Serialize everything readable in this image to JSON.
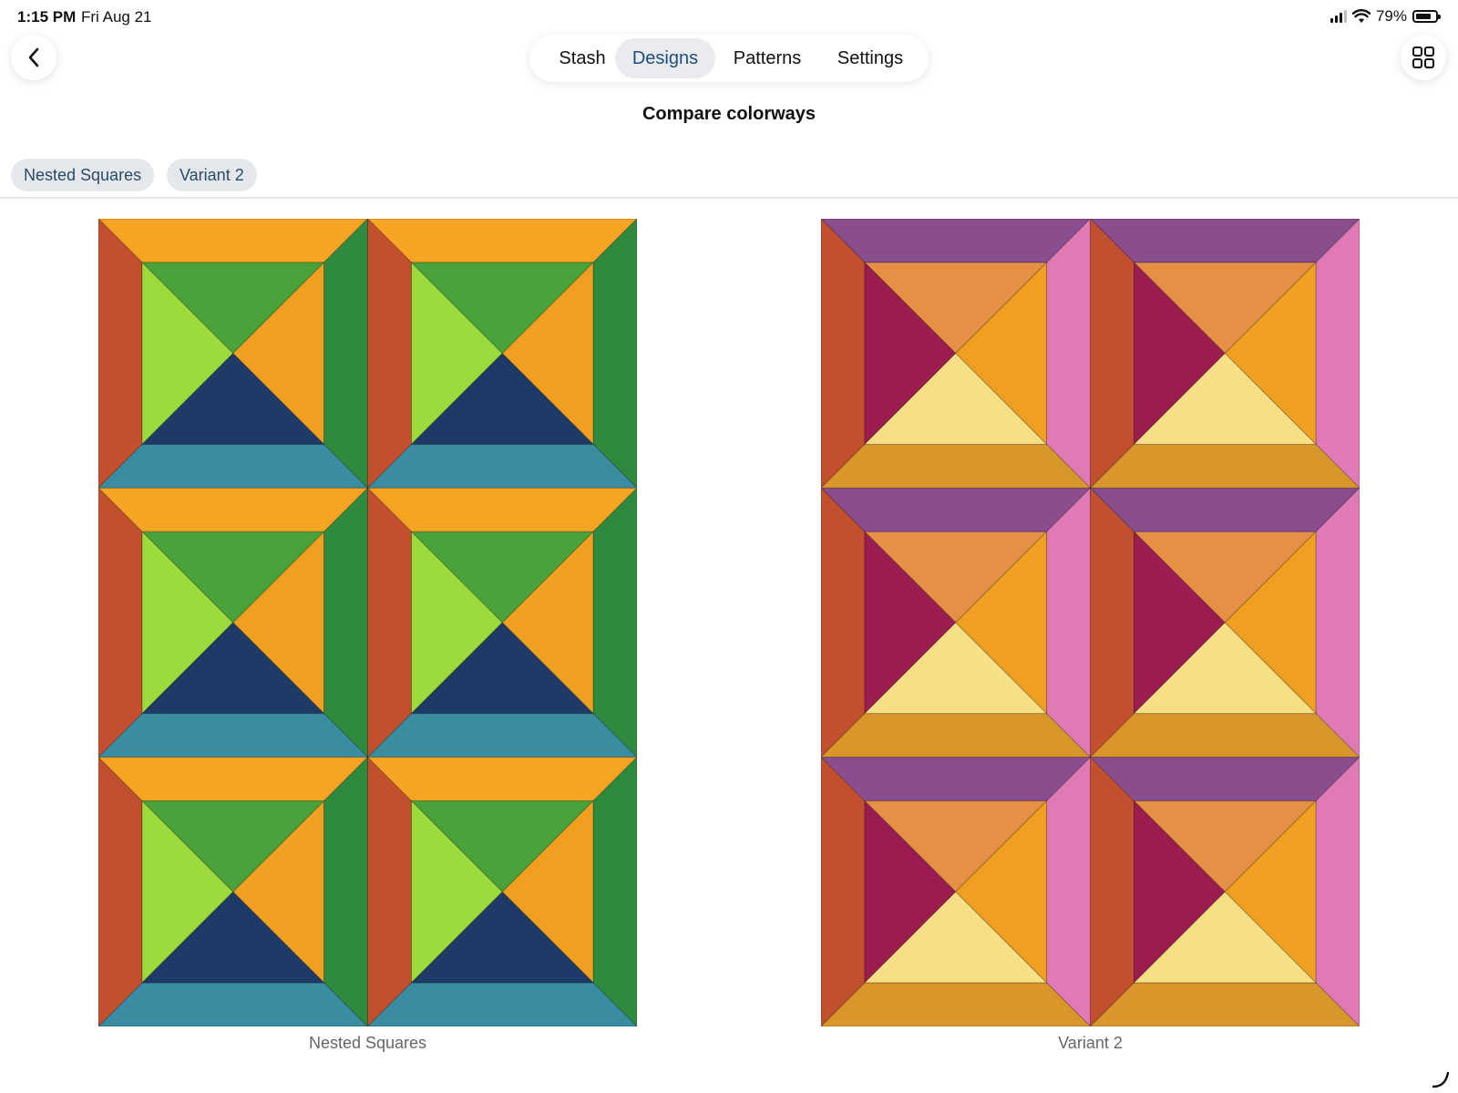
{
  "status_bar": {
    "time": "1:15 PM",
    "date": "Fri Aug 21",
    "battery_text": "79%",
    "battery_level": 0.79
  },
  "nav": {
    "tabs": [
      {
        "label": "Stash",
        "active": false
      },
      {
        "label": "Designs",
        "active": true
      },
      {
        "label": "Patterns",
        "active": false
      },
      {
        "label": "Settings",
        "active": false
      }
    ]
  },
  "page": {
    "title": "Compare colorways"
  },
  "chips": [
    {
      "label": "Nested Squares"
    },
    {
      "label": "Variant 2"
    }
  ],
  "designs": [
    {
      "caption": "Nested Squares",
      "colors": {
        "top": "#f5a523",
        "left": "#c2502e",
        "right": "#2e8b3e",
        "bottom": "#3a8ca0",
        "tri_top": "#4aa33a",
        "tri_left": "#9bdc3c",
        "tri_right": "#f0a020",
        "tri_bottom": "#1e3a66"
      }
    },
    {
      "caption": "Variant 2",
      "colors": {
        "top": "#8a4d8e",
        "left": "#c2502e",
        "right": "#e07ab5",
        "bottom": "#d9962a",
        "tri_top": "#e59044",
        "tri_left": "#9b1d4f",
        "tri_right": "#f0a020",
        "tri_bottom": "#f7df85"
      }
    }
  ],
  "colors": {
    "accent": "#1f4e79",
    "chip_bg": "#e4e8ed"
  }
}
